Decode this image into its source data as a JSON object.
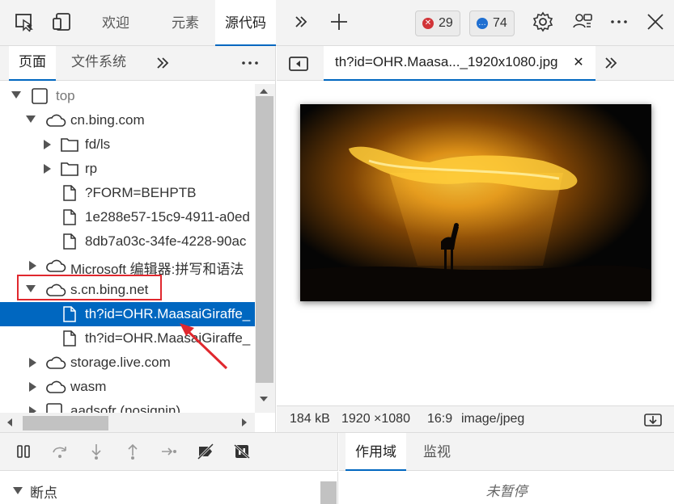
{
  "toolbar": {
    "tabs": [
      "欢迎",
      "元素",
      "源代码"
    ],
    "active_tab": "源代码",
    "errors_count": "29",
    "messages_count": "74"
  },
  "navigator": {
    "tabs": [
      "页面",
      "文件系统"
    ],
    "active_tab": "页面",
    "tree": [
      {
        "label": "top"
      },
      {
        "label": "cn.bing.com"
      },
      {
        "label": "fd/ls"
      },
      {
        "label": "rp"
      },
      {
        "label": "?FORM=BEHPTB"
      },
      {
        "label": "1e288e57-15c9-4911-a0ed"
      },
      {
        "label": "8db7a03c-34fe-4228-90ac"
      },
      {
        "label": "Microsoft 编辑器:拼写和语法"
      },
      {
        "label": "s.cn.bing.net"
      },
      {
        "label": "th?id=OHR.MaasaiGiraffe_"
      },
      {
        "label": "th?id=OHR.MaasaiGiraffe_"
      },
      {
        "label": "storage.live.com"
      },
      {
        "label": "wasm"
      },
      {
        "label": "aadsofr (nosignin)"
      }
    ]
  },
  "preview": {
    "tab_label": "th?id=OHR.Maasa..._1920x1080.jpg",
    "file_size": "184 kB",
    "dimensions": "1920 ×1080",
    "aspect": "16:9",
    "mime": "image/jpeg"
  },
  "debugger": {
    "sections": [
      "断点"
    ],
    "scope_tabs": [
      "作用域",
      "监视"
    ],
    "active_scope_tab": "作用域",
    "status": "未暂停"
  },
  "colors": {
    "accent": "#0067c0",
    "annotation": "#e0282e",
    "error_badge": "#d13438",
    "message_badge": "#1f6fd1"
  }
}
